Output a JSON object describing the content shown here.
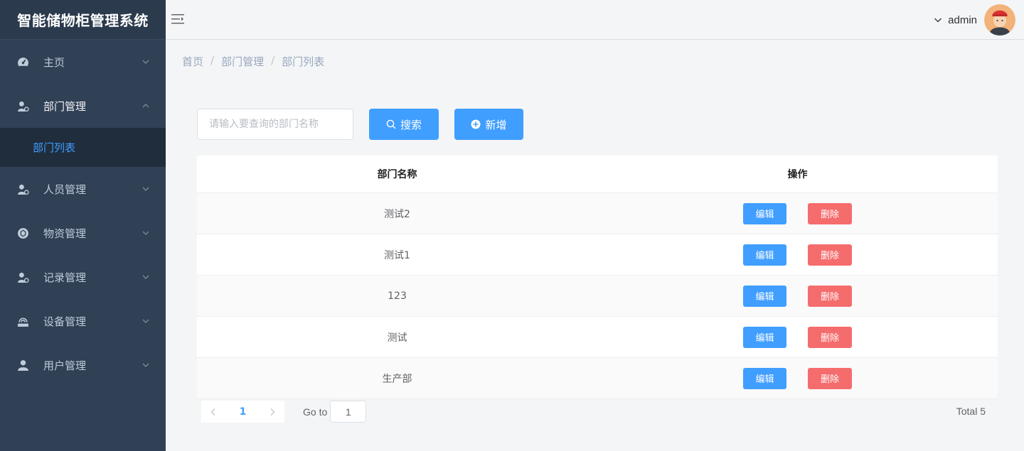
{
  "app": {
    "title": "智能储物柜管理系统"
  },
  "sidebar": {
    "items": [
      {
        "label": "主页",
        "icon": "dashboard-icon"
      },
      {
        "label": "部门管理",
        "icon": "user-settings-icon",
        "expanded": true,
        "children": [
          {
            "label": "部门列表",
            "active": true
          }
        ]
      },
      {
        "label": "人员管理",
        "icon": "user-settings-icon"
      },
      {
        "label": "物资管理",
        "icon": "box-icon"
      },
      {
        "label": "记录管理",
        "icon": "user-settings-icon"
      },
      {
        "label": "设备管理",
        "icon": "device-icon"
      },
      {
        "label": "用户管理",
        "icon": "user-icon"
      }
    ]
  },
  "header": {
    "username": "admin"
  },
  "breadcrumb": [
    "首页",
    "部门管理",
    "部门列表"
  ],
  "search": {
    "placeholder": "请输入要查询的部门名称",
    "value": "",
    "search_label": "搜索",
    "add_label": "新增"
  },
  "table": {
    "columns": [
      "部门名称",
      "操作"
    ],
    "rows": [
      {
        "name": "测试2"
      },
      {
        "name": "测试1"
      },
      {
        "name": "123"
      },
      {
        "name": "测试"
      },
      {
        "name": "生产部"
      }
    ],
    "edit_label": "编辑",
    "delete_label": "删除"
  },
  "pagination": {
    "current_page": "1",
    "goto_label": "Go to",
    "goto_value": "1",
    "total_label": "Total 5"
  },
  "colors": {
    "sidebar_bg": "#304156",
    "primary": "#409eff",
    "danger": "#f56c6c",
    "submenu_bg": "#1f2d3d"
  }
}
